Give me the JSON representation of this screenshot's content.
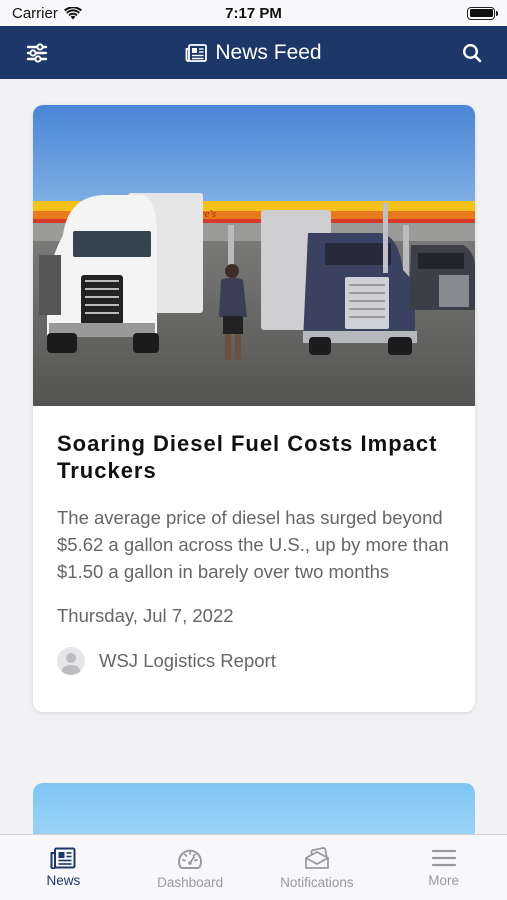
{
  "status_bar": {
    "carrier": "Carrier",
    "time": "7:17 PM"
  },
  "header": {
    "title": "News Feed",
    "filter_icon": "sliders-icon",
    "search_icon": "search-icon"
  },
  "article": {
    "title": "Soaring Diesel Fuel Costs Impact Truckers",
    "description": "The average price of diesel has surged beyond $5.62 a gallon across the U.S., up by more than $1.50 a gallon in barely over two months",
    "date": "Thursday, Jul 7, 2022",
    "source": "WSJ Logistics Report",
    "image_sign": "Love's"
  },
  "tabs": [
    {
      "label": "News",
      "icon": "newspaper-icon",
      "active": true
    },
    {
      "label": "Dashboard",
      "icon": "gauge-icon",
      "active": false
    },
    {
      "label": "Notifications",
      "icon": "envelope-stack-icon",
      "active": false
    },
    {
      "label": "More",
      "icon": "menu-icon",
      "active": false
    }
  ],
  "colors": {
    "nav": "#1d3768",
    "active_tab": "#1d3768",
    "inactive_tab": "#9a9a9e"
  }
}
